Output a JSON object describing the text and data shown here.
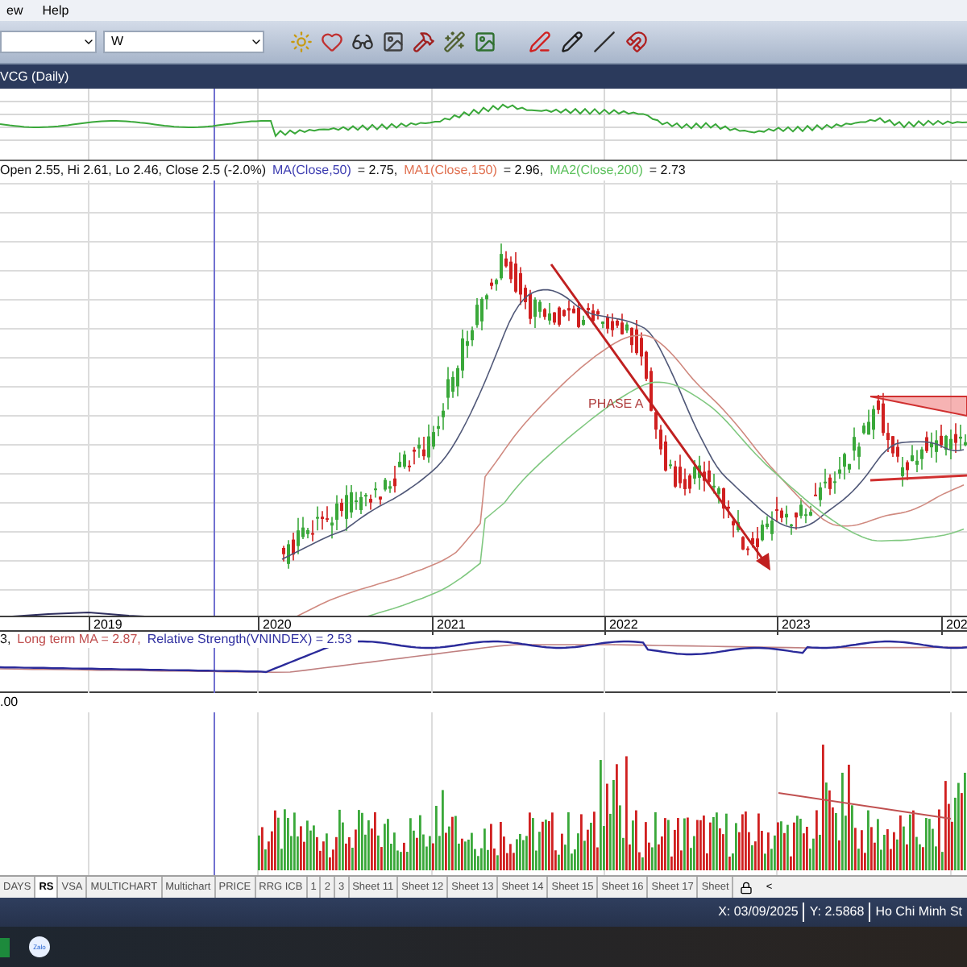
{
  "menu": [
    "ew",
    "Help"
  ],
  "toolbar": {
    "interval_field": {
      "value": "W"
    }
  },
  "chart_window": {
    "title": "VCG (Daily)"
  },
  "price_legend": [
    {
      "text": "Open 2.55, Hi 2.61, Lo 2.46, Close 2.5 (-2.0%)",
      "color": "#111111"
    },
    {
      "text": "MA(Close,50)",
      "color": "#3b3bb0"
    },
    {
      "text": "= 2.75,",
      "color": "#111111"
    },
    {
      "text": "MA1(Close,150)",
      "color": "#e07050"
    },
    {
      "text": "= 2.96,",
      "color": "#111111"
    },
    {
      "text": "MA2(Close,200)",
      "color": "#5cc05c"
    },
    {
      "text": "= 2.73",
      "color": "#111111"
    }
  ],
  "annotation": "PHASE A",
  "x_axis_labels": [
    "2019",
    "2020",
    "2021",
    "2022",
    "2023",
    "202"
  ],
  "rs_legend": [
    {
      "text": "3,",
      "color": "#111111"
    },
    {
      "text": "Long term MA = 2.87,",
      "color": "#c05050"
    },
    {
      "text": "Relative Strength(VNINDEX) = 2.53",
      "color": "#3030a0"
    }
  ],
  "volume_axis_label": ".00",
  "sheet_tabs": [
    {
      "label": "DAYS",
      "selected": false
    },
    {
      "label": "RS",
      "selected": true
    },
    {
      "label": "VSA",
      "selected": false
    },
    {
      "label": "MULTICHART",
      "selected": false
    },
    {
      "label": "Multichart",
      "selected": false
    },
    {
      "label": "PRICE",
      "selected": false
    },
    {
      "label": "RRG ICB",
      "selected": false
    },
    {
      "label": "1",
      "selected": false
    },
    {
      "label": "2",
      "selected": false
    },
    {
      "label": "3",
      "selected": false
    },
    {
      "label": "Sheet 11",
      "selected": false
    },
    {
      "label": "Sheet 12",
      "selected": false
    },
    {
      "label": "Sheet 13",
      "selected": false
    },
    {
      "label": "Sheet 14",
      "selected": false
    },
    {
      "label": "Sheet 15",
      "selected": false
    },
    {
      "label": "Sheet 16",
      "selected": false
    },
    {
      "label": "Sheet 17",
      "selected": false
    },
    {
      "label": "Sheet",
      "selected": false
    }
  ],
  "tab_scroll": "<",
  "status_bar": [
    "X: 03/09/2025",
    "Y: 2.5868",
    "Ho Chi Minh St"
  ],
  "taskbar": [
    {
      "kind": "sheet"
    },
    {
      "kind": "chat",
      "label": "Zalo"
    }
  ]
}
